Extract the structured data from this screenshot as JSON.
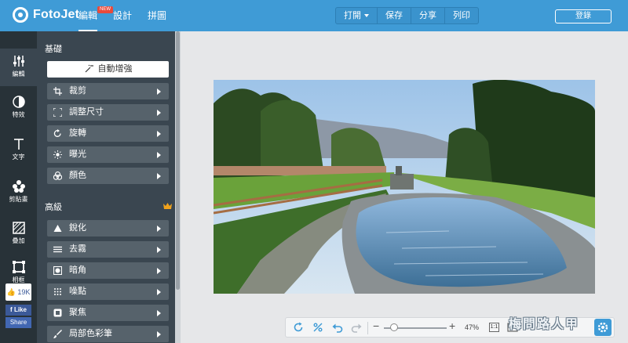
{
  "app": {
    "name": "FotoJet"
  },
  "nav": {
    "tabs": [
      "編輯",
      "設計",
      "拼圖"
    ],
    "active": 0,
    "new_badge": "NEW"
  },
  "actions": {
    "open": "打開",
    "save": "保存",
    "share": "分享",
    "print": "列印"
  },
  "login": "登錄",
  "rail": {
    "items": [
      {
        "label": "編輯",
        "icon": "sliders-icon"
      },
      {
        "label": "特效",
        "icon": "half-circle-icon"
      },
      {
        "label": "文字",
        "icon": "text-icon"
      },
      {
        "label": "剪貼畫",
        "icon": "clipart-icon"
      },
      {
        "label": "疊加",
        "icon": "overlay-icon"
      },
      {
        "label": "相框",
        "icon": "frame-icon"
      }
    ]
  },
  "social": {
    "like_count": "19K",
    "like": "Like",
    "share": "Share"
  },
  "panel": {
    "basic_title": "基礎",
    "auto_enhance": "自動增強",
    "basic_tools": [
      {
        "label": "裁剪",
        "icon": "crop-icon"
      },
      {
        "label": "調整尺寸",
        "icon": "resize-icon"
      },
      {
        "label": "旋轉",
        "icon": "rotate-icon"
      },
      {
        "label": "曝光",
        "icon": "sun-icon"
      },
      {
        "label": "顏色",
        "icon": "color-icon"
      }
    ],
    "advanced_title": "高級",
    "advanced_tools": [
      {
        "label": "銳化",
        "icon": "triangle-icon"
      },
      {
        "label": "去霧",
        "icon": "haze-icon"
      },
      {
        "label": "暗角",
        "icon": "vignette-icon"
      },
      {
        "label": "噪點",
        "icon": "noise-icon"
      },
      {
        "label": "聚焦",
        "icon": "focus-icon"
      },
      {
        "label": "局部色彩筆",
        "icon": "brush-icon"
      }
    ]
  },
  "zoom": {
    "percent": "47%",
    "fit_label": "1:1",
    "level": 0.1
  },
  "watermark": "梅問路人甲",
  "colors": {
    "accent": "#3f9bd6",
    "rail": "#283238",
    "panel": "#3a4650",
    "tool": "#56626b"
  }
}
